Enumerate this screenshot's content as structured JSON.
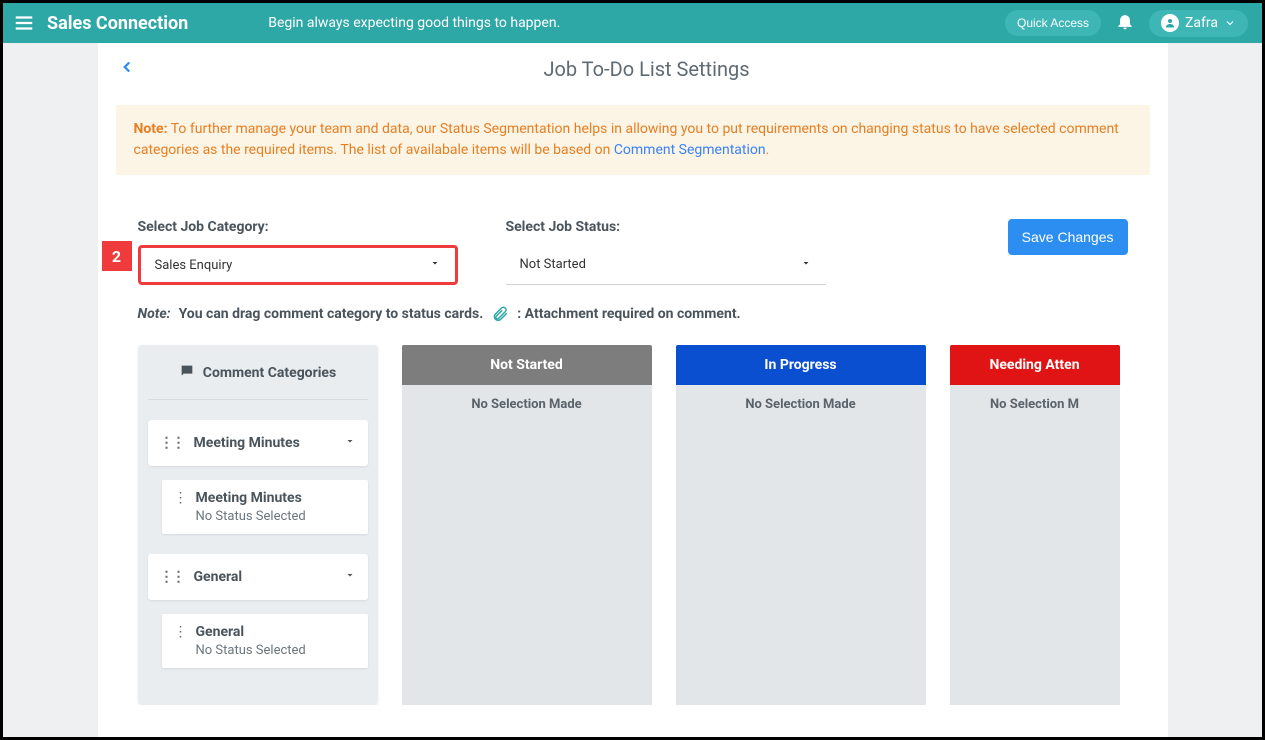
{
  "header": {
    "brand": "Sales Connection",
    "tagline": "Begin always expecting good things to happen.",
    "quick_access": "Quick Access",
    "user_name": "Zafra"
  },
  "page": {
    "title": "Job To-Do List Settings"
  },
  "banner": {
    "label": "Note:",
    "text1": " To further manage your team and data, our Status Segmentation helps in allowing you to put requirements on changing status to have selected comment categories as the required items. The list of availabale items will be based on ",
    "link": "Comment Segmentation",
    "text2": "."
  },
  "form": {
    "cat_label": "Select Job Category:",
    "cat_value": "Sales Enquiry",
    "status_label": "Select Job Status:",
    "status_value": "Not Started",
    "save": "Save Changes",
    "step_badge": "2"
  },
  "dragnote": {
    "prefix": "Note:",
    "text": "You can drag comment category to status cards.",
    "attach_text": ": Attachment required on comment."
  },
  "sidebar": {
    "title": "Comment Categories",
    "groups": [
      {
        "name": "Meeting Minutes",
        "items": [
          {
            "name": "Meeting Minutes",
            "status": "No Status Selected"
          }
        ]
      },
      {
        "name": "General",
        "items": [
          {
            "name": "General",
            "status": "No Status Selected"
          }
        ]
      }
    ]
  },
  "columns": [
    {
      "label": "Not Started",
      "color": "gray",
      "empty": "No Selection Made"
    },
    {
      "label": "In Progress",
      "color": "blue",
      "empty": "No Selection Made"
    },
    {
      "label": "Needing Atten",
      "color": "red",
      "empty": "No Selection M"
    }
  ]
}
